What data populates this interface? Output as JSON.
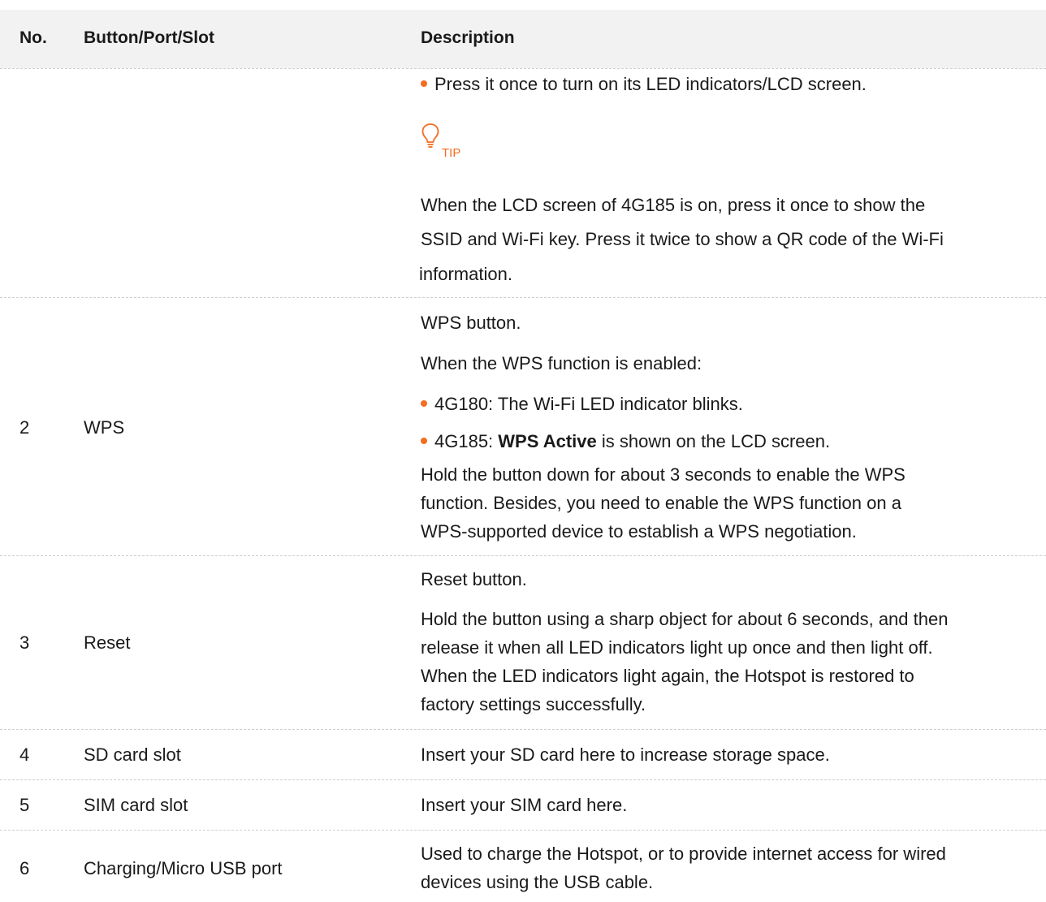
{
  "table": {
    "headers": {
      "no": "No.",
      "item": "Button/Port/Slot",
      "description": "Description"
    },
    "row1": {
      "bullet_press_once": "Press it once to turn on its LED indicators/LCD screen.",
      "tip_label": "TIP",
      "tip_line1": "When the LCD screen of 4G185 is on, press it once to show the",
      "tip_line2": "SSID and Wi-Fi key. Press it twice to show a QR code of the Wi-Fi",
      "tip_line3": "information."
    },
    "row2": {
      "no": "2",
      "item": "WPS",
      "desc_title": "WPS button.",
      "desc_when": "When the WPS function is enabled:",
      "bullet1": "4G180: The Wi-Fi LED indicator blinks.",
      "bullet2_prefix": "4G185: ",
      "bullet2_bold": "WPS Active",
      "bullet2_suffix": " is shown on the LCD screen.",
      "hold_line1": "Hold the button down for about 3 seconds to enable the WPS",
      "hold_line2": "function. Besides, you need to enable the WPS function on a",
      "hold_line3": "WPS-supported device to establish a WPS negotiation."
    },
    "row3": {
      "no": "3",
      "item": "Reset",
      "desc_title": "Reset button.",
      "hold_line1": "Hold the button using a sharp object for about 6 seconds, and then",
      "hold_line2": "release it when all LED indicators light up once and then light off.",
      "hold_line3": "When the LED indicators light again, the Hotspot is restored to",
      "hold_line4": "factory settings successfully."
    },
    "row4": {
      "no": "4",
      "item": "SD card slot",
      "desc": "Insert your SD card here to increase storage space."
    },
    "row5": {
      "no": "5",
      "item": "SIM card slot",
      "desc": "Insert your SIM card here."
    },
    "row6": {
      "no": "6",
      "item": "Charging/Micro USB port",
      "desc_line1": "Used to charge the Hotspot, or to provide internet access for wired",
      "desc_line2": "devices using the USB cable."
    }
  },
  "colors": {
    "accent": "#f26d21",
    "header_bg": "#f2f2f2",
    "rule": "#cfcfcf"
  },
  "icons": {
    "tip": "lightbulb-icon",
    "bullet": "orange-dot-bullet"
  }
}
